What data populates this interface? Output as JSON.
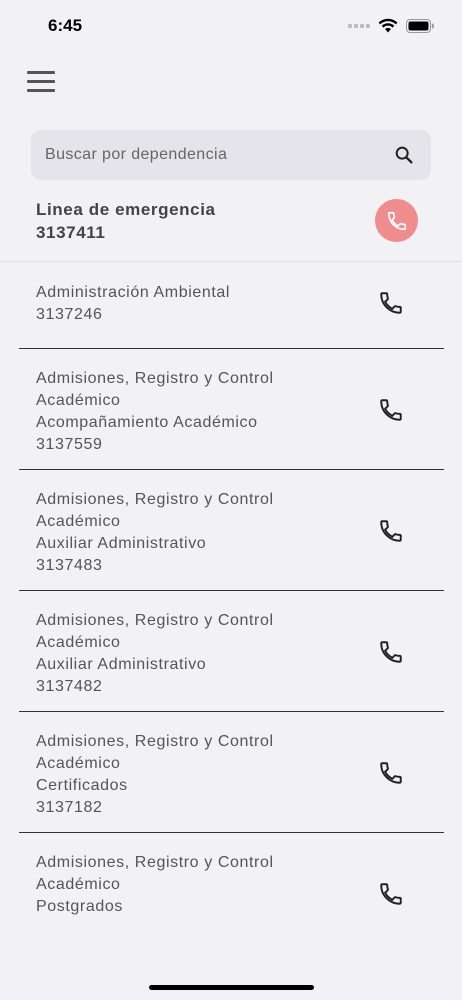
{
  "status_bar": {
    "time": "6:45"
  },
  "search": {
    "placeholder": "Buscar por dependencia",
    "value": ""
  },
  "emergency": {
    "title": "Linea de emergencia",
    "number": "3137411",
    "accent": "#ee8c8e"
  },
  "contacts": [
    {
      "dependency": "Administración Ambiental",
      "dependency_cont": "",
      "area": "",
      "number": "3137246"
    },
    {
      "dependency": "Admisiones, Registro y Control",
      "dependency_cont": "Académico",
      "area": "Acompañamiento Académico",
      "number": "3137559"
    },
    {
      "dependency": "Admisiones, Registro y Control",
      "dependency_cont": "Académico",
      "area": "Auxiliar Administrativo",
      "number": "3137483"
    },
    {
      "dependency": "Admisiones, Registro y Control",
      "dependency_cont": "Académico",
      "area": "Auxiliar Administrativo",
      "number": "3137482"
    },
    {
      "dependency": "Admisiones, Registro y Control",
      "dependency_cont": "Académico",
      "area": "Certificados",
      "number": "3137182"
    },
    {
      "dependency": "Admisiones, Registro y Control",
      "dependency_cont": "Académico",
      "area": "Postgrados",
      "number": ""
    }
  ],
  "icons": {
    "menu": "menu-icon",
    "search": "search-icon",
    "call": "phone-icon"
  }
}
